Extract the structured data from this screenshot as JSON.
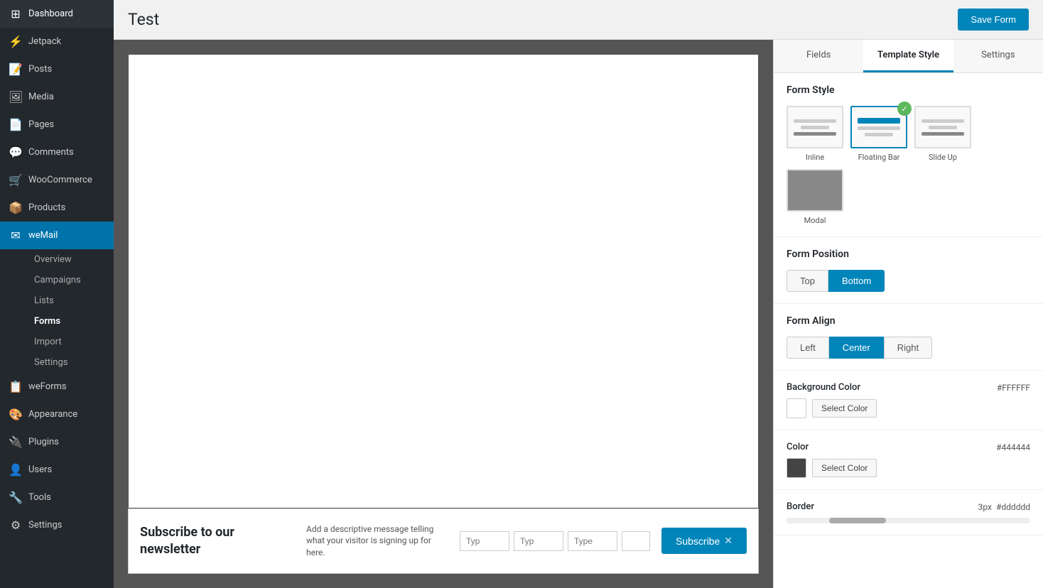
{
  "sidebar": {
    "items": [
      {
        "id": "dashboard",
        "label": "Dashboard",
        "icon": "⊞"
      },
      {
        "id": "jetpack",
        "label": "Jetpack",
        "icon": "⚡"
      },
      {
        "id": "posts",
        "label": "Posts",
        "icon": "📝"
      },
      {
        "id": "media",
        "label": "Media",
        "icon": "🖼"
      },
      {
        "id": "pages",
        "label": "Pages",
        "icon": "📄"
      },
      {
        "id": "comments",
        "label": "Comments",
        "icon": "💬"
      },
      {
        "id": "woocommerce",
        "label": "WooCommerce",
        "icon": "🛒"
      },
      {
        "id": "products",
        "label": "Products",
        "icon": "📦"
      },
      {
        "id": "wemail",
        "label": "weMail",
        "icon": "✉"
      }
    ],
    "sub_items": [
      {
        "id": "overview",
        "label": "Overview"
      },
      {
        "id": "campaigns",
        "label": "Campaigns"
      },
      {
        "id": "lists",
        "label": "Lists"
      },
      {
        "id": "forms",
        "label": "Forms",
        "active": true
      },
      {
        "id": "import",
        "label": "Import"
      },
      {
        "id": "settings",
        "label": "Settings"
      }
    ],
    "bottom_items": [
      {
        "id": "weforms",
        "label": "weForms",
        "icon": "📋"
      },
      {
        "id": "appearance",
        "label": "Appearance",
        "icon": "🎨"
      },
      {
        "id": "plugins",
        "label": "Plugins",
        "icon": "🔌"
      },
      {
        "id": "users",
        "label": "Users",
        "icon": "👤"
      },
      {
        "id": "tools",
        "label": "Tools",
        "icon": "🔧"
      },
      {
        "id": "settings2",
        "label": "Settings",
        "icon": "⚙"
      }
    ]
  },
  "page": {
    "title": "Test",
    "save_button": "Save Form"
  },
  "panel": {
    "tabs": [
      {
        "id": "fields",
        "label": "Fields"
      },
      {
        "id": "template_style",
        "label": "Template Style",
        "active": true
      },
      {
        "id": "settings",
        "label": "Settings"
      }
    ],
    "form_style": {
      "title": "Form Style",
      "items": [
        {
          "id": "inline",
          "label": "Inline",
          "selected": false
        },
        {
          "id": "floating_bar",
          "label": "Floating Bar",
          "selected": true
        },
        {
          "id": "slide_up",
          "label": "Slide Up",
          "selected": false
        },
        {
          "id": "modal",
          "label": "Modal",
          "selected": false
        }
      ]
    },
    "form_position": {
      "title": "Form Position",
      "buttons": [
        {
          "id": "top",
          "label": "Top",
          "active": false
        },
        {
          "id": "bottom",
          "label": "Bottom",
          "active": true
        }
      ]
    },
    "form_align": {
      "title": "Form Align",
      "buttons": [
        {
          "id": "left",
          "label": "Left",
          "active": false
        },
        {
          "id": "center",
          "label": "Center",
          "active": true
        },
        {
          "id": "right",
          "label": "Right",
          "active": false
        }
      ]
    },
    "background_color": {
      "title": "Background Color",
      "value": "#FFFFFF",
      "swatch_color": "#FFFFFF",
      "select_label": "Select Color"
    },
    "color": {
      "title": "Color",
      "value": "#444444",
      "swatch_color": "#444444",
      "select_label": "Select Color"
    },
    "border": {
      "title": "Border",
      "size": "3px",
      "color": "#dddddd"
    }
  },
  "preview": {
    "subscribe_heading": "Subscribe to our newsletter",
    "subscribe_desc": "Add a descriptive message telling what your visitor is signing up for here.",
    "fields": [
      {
        "placeholder": "Typ"
      },
      {
        "placeholder": "Typ"
      },
      {
        "placeholder": "Type"
      },
      {
        "placeholder": ""
      }
    ],
    "subscribe_button": "Subscribe",
    "close_symbol": "✕"
  }
}
